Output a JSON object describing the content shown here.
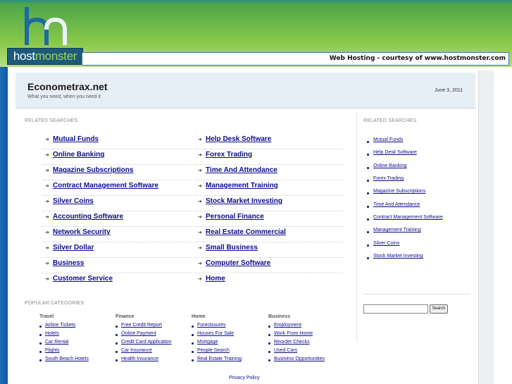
{
  "header": {
    "logo_host": "host",
    "logo_monster": "monster",
    "banner_text": "Web Hosting - courtesy of www.hostmonster.com"
  },
  "site": {
    "title": "Econometrax.net",
    "tagline": "What you need, when you need it",
    "date": "June 3, 2011"
  },
  "related_searches": {
    "label": "RELATED SEARCHES",
    "left": [
      "Mutual Funds",
      "Online Banking",
      "Magazine Subscriptions",
      "Contract Management Software",
      "Silver Coins",
      "Accounting Software",
      "Network Security",
      "Silver Dollar",
      "Business",
      "Customer Service"
    ],
    "right": [
      "Help Desk Software",
      "Forex Trading",
      "Time And Attendance",
      "Management Training",
      "Stock Market Investing",
      "Personal Finance",
      "Real Estate Commercial",
      "Small Business",
      "Computer Software",
      "Home"
    ]
  },
  "sidebar": {
    "label": "RELATED SEARCHES",
    "items": [
      "Mutual Funds",
      "Help Desk Software",
      "Online Banking",
      "Forex Trading",
      "Magazine Subscriptions",
      "Time And Attendance",
      "Contract Management Software",
      "Management Training",
      "Silver Coins",
      "Stock Market Investing"
    ],
    "search_value": "",
    "search_button": "Search"
  },
  "popular": {
    "label": "POPULAR CATEGORIES",
    "columns": [
      {
        "title": "Travel",
        "links": [
          "Airline Tickets",
          "Hotels",
          "Car Rental",
          "Flights",
          "South Beach Hotels"
        ]
      },
      {
        "title": "Finance",
        "links": [
          "Free Credit Report",
          "Online Payment",
          "Credit Card Application",
          "Car Insurance",
          "Health Insurance"
        ]
      },
      {
        "title": "Home",
        "links": [
          "Foreclosures",
          "Houses For Sale",
          "Mortgage",
          "People Search",
          "Real Estate Training"
        ]
      },
      {
        "title": "Business",
        "links": [
          "Employment",
          "Work From Home",
          "Reorder Checks",
          "Used Cars",
          "Business Opportunities"
        ]
      }
    ]
  },
  "footer": {
    "privacy": "Privacy Policy"
  },
  "colors": {
    "link": "#0c0c8c",
    "header_blue": "#1d5a7a",
    "header_green": "#9fd35a"
  },
  "icons": {
    "logo": "hm-logo-icon",
    "bullet": "arrow-bullet-icon"
  }
}
